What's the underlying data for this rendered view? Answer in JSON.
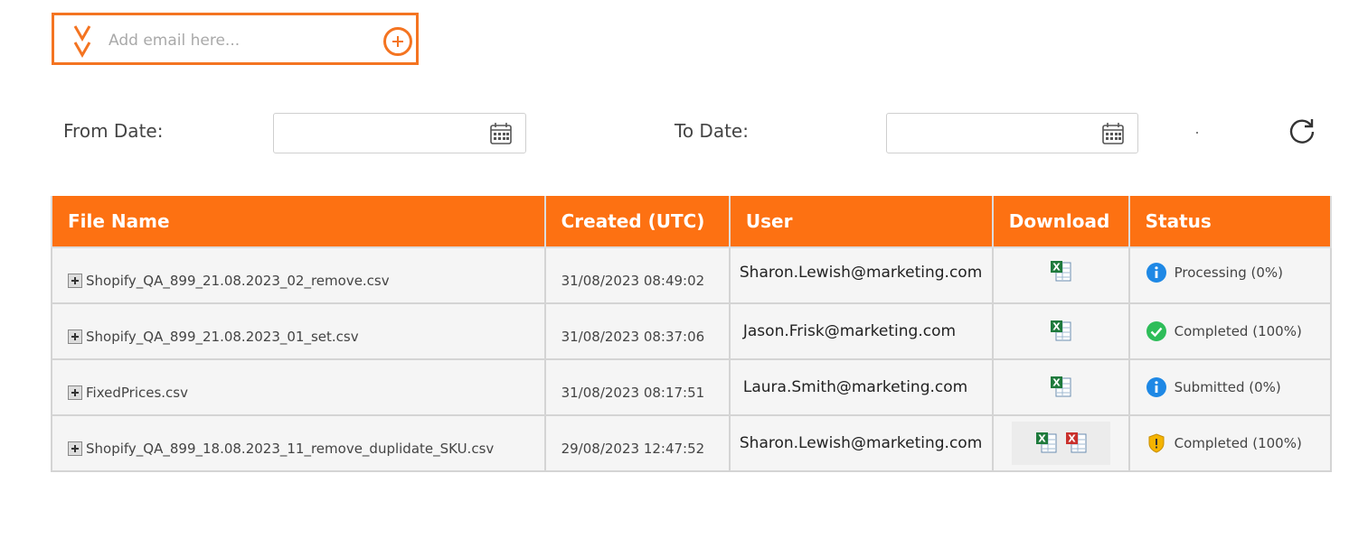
{
  "email": {
    "placeholder": "Add email here..."
  },
  "filters": {
    "from_label": "From Date:",
    "to_label": "To Date:",
    "from_value": "",
    "to_value": "",
    "separator": "."
  },
  "table": {
    "headers": [
      "File Name",
      "Created (UTC)",
      "User",
      "Download",
      "Status"
    ],
    "rows": [
      {
        "file": "Shopify_QA_899_21.08.2023_02_remove.csv",
        "created": "31/08/2023 08:49:02",
        "user": "Sharon.Lewish@marketing.com",
        "download": [
          "excel-icon"
        ],
        "status": "Processing (0%)",
        "status_icon": "info-icon"
      },
      {
        "file": "Shopify_QA_899_21.08.2023_01_set.csv",
        "created": "31/08/2023 08:37:06",
        "user": "Jason.Frisk@marketing.com",
        "download": [
          "excel-icon"
        ],
        "status": "Completed (100%)",
        "status_icon": "check-icon"
      },
      {
        "file": "FixedPrices.csv",
        "created": "31/08/2023 08:17:51",
        "user": "Laura.Smith@marketing.com",
        "download": [
          "excel-icon"
        ],
        "status": "Submitted (0%)",
        "status_icon": "info-icon"
      },
      {
        "file": "Shopify_QA_899_18.08.2023_11_remove_duplidate_SKU.csv",
        "created": "29/08/2023 12:47:52",
        "user": "Sharon.Lewish@marketing.com",
        "download": [
          "excel-icon",
          "excel-error-icon"
        ],
        "status": "Completed (100%)",
        "status_icon": "warning-shield-icon"
      }
    ]
  },
  "colors": {
    "accent": "#fd7112",
    "border_accent": "#f47421",
    "info": "#1e88e5",
    "success": "#2ebd59",
    "warning": "#f5b400"
  }
}
